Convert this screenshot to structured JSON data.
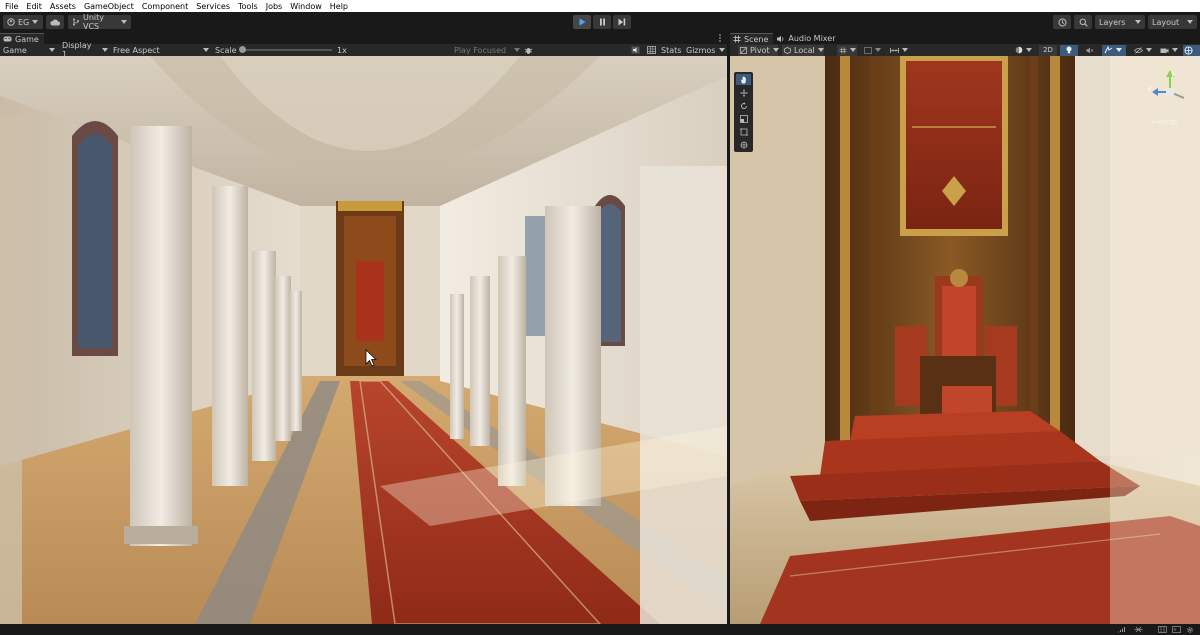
{
  "menu": [
    "File",
    "Edit",
    "Assets",
    "GameObject",
    "Component",
    "Services",
    "Tools",
    "Jobs",
    "Window",
    "Help"
  ],
  "toolbar": {
    "account": "EG",
    "vcs": "Unity VCS",
    "layers": "Layers",
    "layout": "Layout"
  },
  "game": {
    "tab": "Game",
    "mode": "Game",
    "display": "Display 1",
    "aspect": "Free Aspect",
    "scale_label": "Scale",
    "scale_value": "1x",
    "play_focused": "Play Focused",
    "stats": "Stats",
    "gizmos": "Gizmos"
  },
  "scene": {
    "tab": "Scene",
    "tab2": "Audio Mixer",
    "pivot": "Pivot",
    "local": "Local",
    "mode2d": "2D",
    "persp": "←Persp"
  },
  "colors": {
    "accent": "#4aa3ff",
    "carpet": "#a8321e",
    "stone": "#d8cfc0",
    "floor": "#c89a62"
  }
}
